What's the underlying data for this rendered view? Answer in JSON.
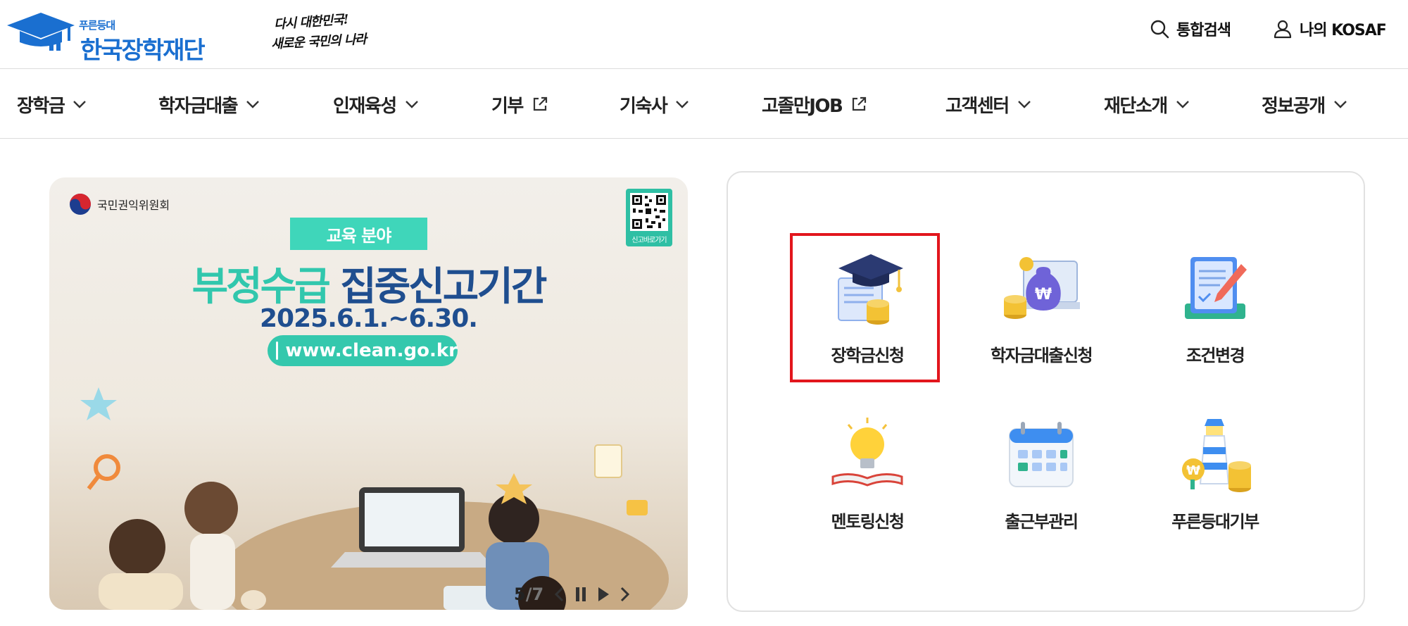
{
  "header": {
    "logo": {
      "sub": "푸른등대",
      "main": "한국장학재단"
    },
    "slogan": {
      "line1": "다시 대한민국!",
      "line2": "새로운 국민의 나라"
    },
    "utility": {
      "search_label": "통합검색",
      "my_label": "나의 KOSAF"
    }
  },
  "gnb": {
    "items": [
      {
        "label": "장학금",
        "icon": "chevron-down-icon"
      },
      {
        "label": "학자금대출",
        "icon": "chevron-down-icon"
      },
      {
        "label": "인재육성",
        "icon": "chevron-down-icon"
      },
      {
        "label": "기부",
        "icon": "external-link-icon"
      },
      {
        "label": "기숙사",
        "icon": "chevron-down-icon"
      },
      {
        "label": "고졸만JOB",
        "icon": "external-link-icon"
      },
      {
        "label": "고객센터",
        "icon": "chevron-down-icon"
      },
      {
        "label": "재단소개",
        "icon": "chevron-down-icon"
      },
      {
        "label": "정보공개",
        "icon": "chevron-down-icon"
      }
    ]
  },
  "banner": {
    "org": "국민권익위원회",
    "qr_label": "신고바로가기",
    "tag": "교육 분야",
    "headline_highlight": "부정수급",
    "headline_rest": "집중신고기간",
    "period": "2025.6.1.~6.30.",
    "url": "www.clean.go.kr",
    "slide_current": "5",
    "slide_total": "/7"
  },
  "quick_menu": {
    "items": [
      {
        "label": "장학금신청",
        "icon": "graduation-cap-coins-icon",
        "highlighted": true
      },
      {
        "label": "학자금대출신청",
        "icon": "money-bag-laptop-icon"
      },
      {
        "label": "조건변경",
        "icon": "document-pencil-icon"
      },
      {
        "label": "멘토링신청",
        "icon": "lightbulb-book-icon"
      },
      {
        "label": "출근부관리",
        "icon": "calendar-icon"
      },
      {
        "label": "푸른등대기부",
        "icon": "lighthouse-coins-icon"
      }
    ]
  },
  "colors": {
    "brand_blue": "#1a6fd0",
    "accent_mint": "#34c8ad",
    "highlight_red": "#e2161d"
  }
}
